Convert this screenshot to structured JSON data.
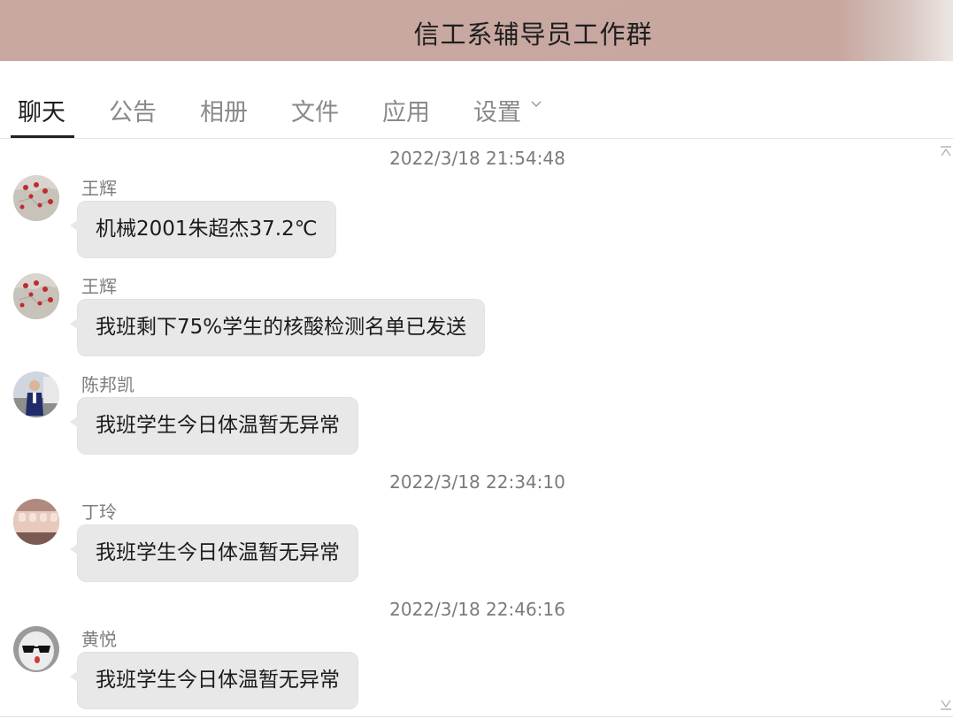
{
  "window": {
    "title": "信工系辅导员工作群",
    "colors": {
      "titlebar": "#c9a8a1",
      "bubble": "#e8e8e8"
    }
  },
  "tabs": [
    {
      "label": "聊天",
      "active": true
    },
    {
      "label": "公告",
      "active": false
    },
    {
      "label": "相册",
      "active": false
    },
    {
      "label": "文件",
      "active": false
    },
    {
      "label": "应用",
      "active": false
    },
    {
      "label": "设置",
      "active": false,
      "icon": "chevron-down-icon"
    }
  ],
  "chat": {
    "timestamps": [
      "2022/3/18 21:54:48",
      "2022/3/18 22:34:10",
      "2022/3/18 22:46:16"
    ],
    "messages": [
      {
        "sender": "王辉",
        "text": "机械2001朱超杰37.2℃",
        "avatar": "map-avatar"
      },
      {
        "sender": "王辉",
        "text": "我班剩下75%学生的核酸检测名单已发送",
        "avatar": "map-avatar"
      },
      {
        "sender": "陈邦凯",
        "text": "我班学生今日体温暂无异常",
        "avatar": "person-avatar"
      },
      {
        "sender": "丁玲",
        "text": "我班学生今日体温暂无异常",
        "avatar": "hands-avatar"
      },
      {
        "sender": "黄悦",
        "text": "我班学生今日体温暂无异常",
        "avatar": "sunglasses-avatar"
      }
    ],
    "icons": {
      "top": "scroll-to-top-icon",
      "bottom": "scroll-to-bottom-icon"
    }
  }
}
